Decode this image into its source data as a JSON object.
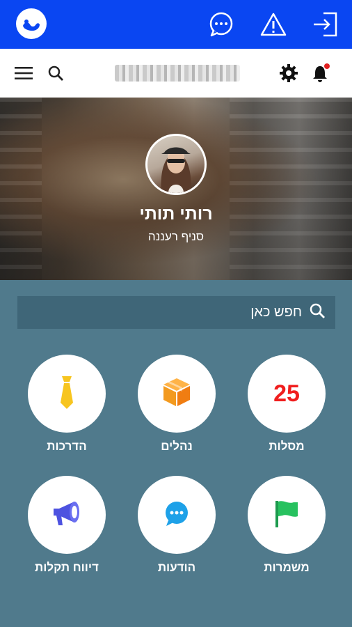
{
  "topbar": {
    "logo_icon": "app-logo-icon",
    "icons": [
      "chat-bubble-icon",
      "warning-triangle-icon",
      "logout-icon"
    ],
    "color": "#0a46f2"
  },
  "navbar": {
    "left_icons": [
      "menu-icon",
      "search-icon"
    ],
    "right_icons": [
      "gear-icon",
      "bell-icon"
    ],
    "bell_dot_color": "#e02020"
  },
  "profile": {
    "name": "רותי תותי",
    "branch": "סניף רעננה"
  },
  "search": {
    "placeholder": "חפש כאן"
  },
  "tiles": [
    {
      "label": "הדרכות",
      "icon": "tie-icon"
    },
    {
      "label": "נהלים",
      "icon": "box-icon"
    },
    {
      "label": "מסלות",
      "count": "25"
    },
    {
      "label": "דיווח תקלות",
      "icon": "megaphone-icon"
    },
    {
      "label": "הודעות",
      "icon": "chat-icon"
    },
    {
      "label": "משמרות",
      "icon": "flag-icon"
    }
  ]
}
